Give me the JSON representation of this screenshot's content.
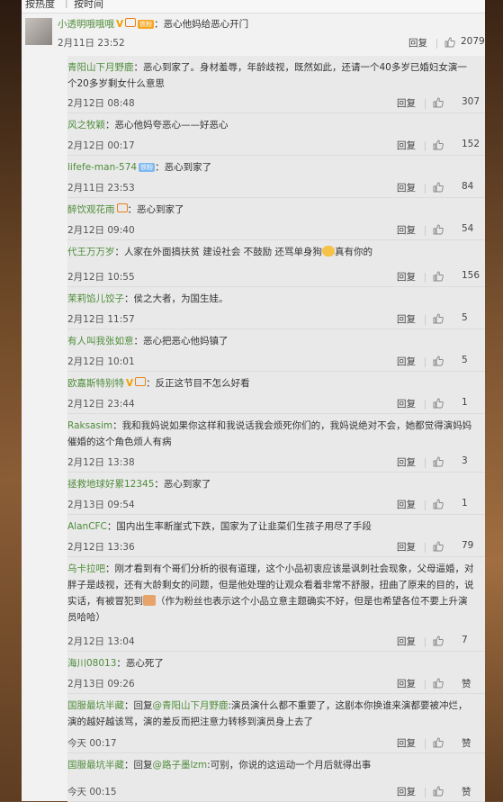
{
  "sort": {
    "hot": "按热度",
    "time": "按时间"
  },
  "actions": {
    "reply": "回复"
  },
  "colors": {
    "username": "#4f8d3a",
    "vip": "#f6a623",
    "fans": "#7fb7ee"
  },
  "top": {
    "user": "小透明哦哦哦",
    "badge": "铁粉",
    "text": "：恶心他妈给恶心开门",
    "time": "2月11日 23:52",
    "likes": "2079"
  },
  "replies": [
    {
      "user": "青阳山下月野鹿",
      "text": "：恶心到家了。身材羞辱，年龄歧视，既然如此，还请一个40多岁已婚妇女演一个20多岁剩女什么意思",
      "time": "2月12日 08:48",
      "likes": "307"
    },
    {
      "user": "风之牧颖",
      "text": "：恶心他妈夸恶心——好恶心",
      "time": "2月12日 00:17",
      "likes": "152"
    },
    {
      "user": "lifefe-man-574",
      "badge": "铁粉",
      "text": "：恶心到家了",
      "time": "2月11日 23:53",
      "likes": "84"
    },
    {
      "user": "醉饮观花雨",
      "text": "：恶心到家了",
      "time": "2月12日 09:40",
      "likes": "54"
    },
    {
      "user": "代王万万岁",
      "text": "：人家在外面搞扶贫 建设社会 不鼓励 还骂单身狗",
      "text2": "真有你的",
      "time": "2月12日 10:55",
      "likes": "156"
    },
    {
      "user": "茉莉馅儿饺子",
      "text": "：侯之大者，为国生娃。",
      "time": "2月12日 11:57",
      "likes": "5"
    },
    {
      "user": "有人叫我张如意",
      "text": "：恶心把恶心他妈镇了",
      "time": "2月12日 10:01",
      "likes": "5"
    },
    {
      "user": "欧嘉斯特别特",
      "text": "：反正这节目不怎么好看",
      "time": "2月12日 23:44",
      "likes": "1"
    },
    {
      "user": "Raksasim",
      "text": "：我和我妈说如果你这样和我说话我会烦死你们的，我妈说绝对不会，她都觉得演妈妈催婚的这个角色烦人有病",
      "time": "2月12日 13:38",
      "likes": "3"
    },
    {
      "user": "拯救地球好累12345",
      "text": "：恶心到家了",
      "time": "2月13日 09:54",
      "likes": "1"
    },
    {
      "user": "AlanCFC",
      "text": "：国内出生率断崖式下跌，国家为了让韭菜们生孩子用尽了手段",
      "time": "2月12日 13:36",
      "likes": "79"
    },
    {
      "user": "乌卡拉吧",
      "text": "：刚才看到有个哥们分析的很有道理，这个小品初衷应该是讽刺社会现象，父母逼婚，对胖子是歧视，还有大龄剩女的问题，但是他处理的让观众看着非常不舒服，扭曲了原来的目的，说实话，有被冒犯到",
      "text2": "（作为粉丝也表示这个小品立意主题确实不好，但是也希望各位不要上升演员哈哈）",
      "time": "2月12日 13:04",
      "likes": "7"
    },
    {
      "user": "海川08013",
      "text": "：恶心死了",
      "time": "2月13日 09:26",
      "likes": "赞"
    },
    {
      "user": "国服最坑半藏",
      "text": "：回复",
      "mention": "@青阳山下月野鹿",
      "text2": ":演员演什么都不重要了，这剧本你换谁来演都要被冲烂，演的越好越该骂，演的差反而把注意力转移到演员身上去了",
      "time": "今天 00:17",
      "likes": "赞"
    },
    {
      "user": "国服最坑半藏",
      "text": "：回复",
      "mention": "@路子墨lzm",
      "text2": ":可别，你说的这运动一个月后就得出事",
      "time": "今天 00:15",
      "likes": "赞"
    }
  ]
}
